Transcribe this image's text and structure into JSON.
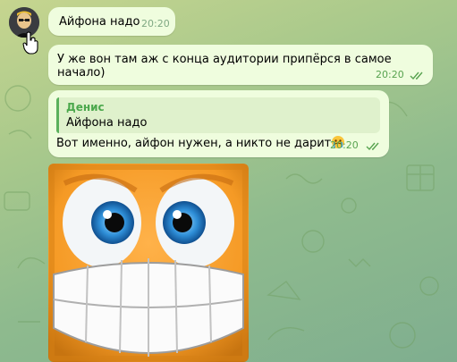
{
  "chat": {
    "messages": [
      {
        "text": "Айфона надо",
        "time": "20:20"
      },
      {
        "text": "У же вон там аж с конца аудитории припёрся в самое начало)",
        "time": "20:20"
      },
      {
        "reply": {
          "author": "Денис",
          "text": "Айфона надо"
        },
        "text": "Вот именно, айфон нужен, а никто не дарит",
        "time": "20:20"
      }
    ]
  },
  "icons": {
    "read_receipt": "double-check-icon",
    "emoji": "crying-face-emoji",
    "cursor": "hand-pointer-icon"
  },
  "colors": {
    "bubble": "#effdde",
    "accent": "#4ba84c",
    "time": "#58a350"
  }
}
